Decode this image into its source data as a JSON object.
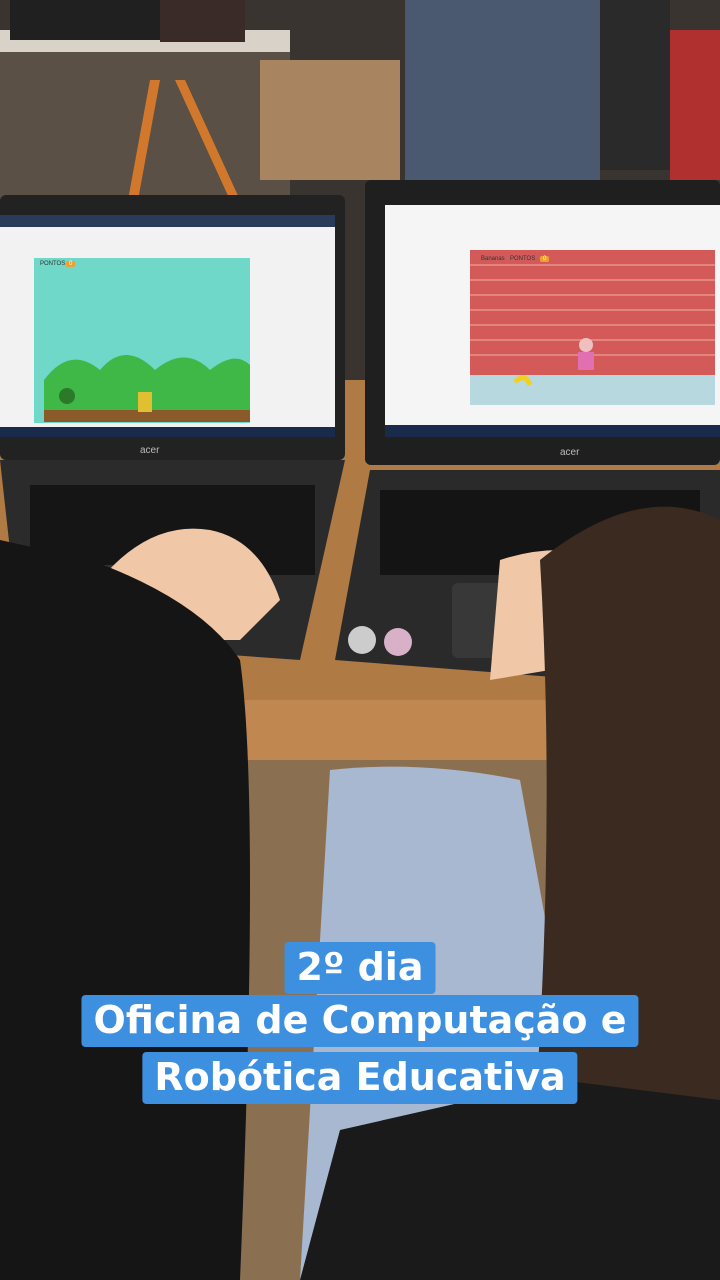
{
  "photo": {
    "laptop_brand_left": "acer",
    "laptop_brand_right": "acer",
    "left_screen": {
      "score_label": "PONTOS",
      "score_value": "0"
    },
    "right_screen": {
      "sprite_label": "Bananas",
      "score_label": "PONTOS",
      "score_value": "0"
    }
  },
  "caption": {
    "line1": "2º dia",
    "line2": "Oficina de Computação e",
    "line3": "Robótica Educativa"
  }
}
